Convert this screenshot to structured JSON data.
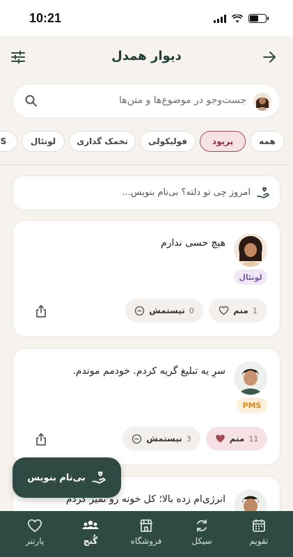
{
  "status": {
    "time": "10:21"
  },
  "header": {
    "title": "دیوار همدل"
  },
  "search": {
    "placeholder": "جست‌وجو در موضوع‌ها و متن‌ها"
  },
  "chips": [
    {
      "label": "همه",
      "active": false
    },
    {
      "label": "پریود",
      "active": true
    },
    {
      "label": "فولیکولی",
      "active": false
    },
    {
      "label": "تخمک گذاری",
      "active": false
    },
    {
      "label": "لوتئال",
      "active": false
    },
    {
      "label": "S",
      "active": false
    }
  ],
  "compose": {
    "text": "امروز چی تو دلته؟ بی‌نام بنویس..."
  },
  "posts": [
    {
      "text": "هیچ حسی ندارم",
      "tag": "لوتئال",
      "me_too": {
        "label": "منم",
        "count": "1"
      },
      "not_me": {
        "label": "نیستمش",
        "count": "0"
      }
    },
    {
      "text": "سرِ یه تبلیغ گریه کردم. خودمم موندم.",
      "tag": "PMS",
      "me_too": {
        "label": "منم",
        "count": "11"
      },
      "not_me": {
        "label": "نیستمش",
        "count": "3"
      }
    },
    {
      "text": "انرژی‌ام زده بالا؛ کل خونه رو تمیز کردم"
    }
  ],
  "fab": {
    "label": "بی‌نام بنویس"
  },
  "tabs": [
    {
      "label": "تقویم",
      "icon": "calendar-icon"
    },
    {
      "label": "سیکل",
      "icon": "cycle-icon"
    },
    {
      "label": "فروشگاه",
      "icon": "store-icon"
    },
    {
      "label": "گُنج",
      "icon": "community-icon",
      "active": true
    },
    {
      "label": "پارتنر",
      "icon": "heart-icon"
    }
  ],
  "colors": {
    "primary": "#2f4a43",
    "accent": "#a44a57",
    "background": "#f6f2ee"
  }
}
